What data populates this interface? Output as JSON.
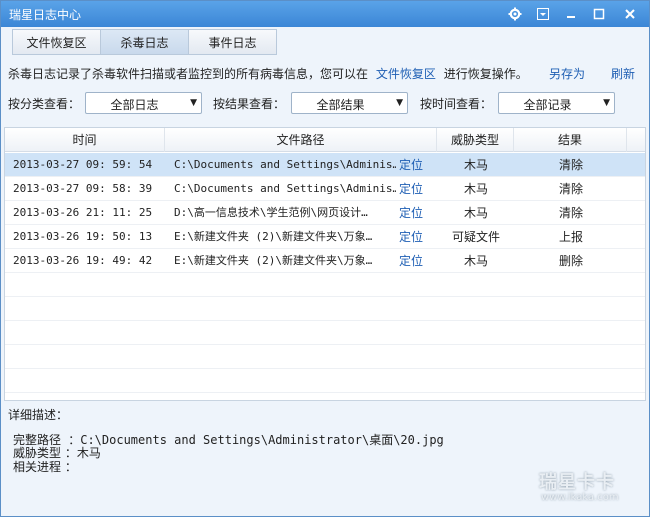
{
  "window": {
    "title": "瑞星日志中心"
  },
  "titlebar_icons": {
    "settings": "gear-icon",
    "menu": "dropdown-menu-icon",
    "minimize": "minimize-icon",
    "maximize": "maximize-icon",
    "close": "close-icon"
  },
  "tabs": [
    {
      "label": "文件恢复区"
    },
    {
      "label": "杀毒日志",
      "active": true
    },
    {
      "label": "事件日志"
    }
  ],
  "info": {
    "text_before": "杀毒日志记录了杀毒软件扫描或者监控到的所有病毒信息，您可以在",
    "link": "文件恢复区",
    "text_after": "进行恢复操作。",
    "save_as": "另存为",
    "refresh": "刷新"
  },
  "filters": {
    "category_label": "按分类查看：",
    "category_value": "全部日志",
    "result_label": "按结果查看：",
    "result_value": "全部结果",
    "time_label": "按时间查看：",
    "time_value": "全部记录"
  },
  "table": {
    "columns": [
      "时间",
      "文件路径",
      "威胁类型",
      "结果"
    ],
    "locate_label": "定位",
    "rows": [
      {
        "time": "2013-03-27 09: 59: 54",
        "path": "C:\\Documents  and Settings\\Adminis…",
        "type": "木马",
        "result": "清除",
        "selected": true
      },
      {
        "time": "2013-03-27 09: 58: 39",
        "path": "C:\\Documents  and Settings\\Adminis…",
        "type": "木马",
        "result": "清除"
      },
      {
        "time": "2013-03-26 21: 11: 25",
        "path": "D:\\高一信息技术\\学生范例\\网页设计…",
        "type": "木马",
        "result": "清除"
      },
      {
        "time": "2013-03-26 19: 50: 13",
        "path": "E:\\新建文件夹  (2)\\新建文件夹\\万象…",
        "type": "可疑文件",
        "result": "上报"
      },
      {
        "time": "2013-03-26 19: 49: 42",
        "path": "E:\\新建文件夹  (2)\\新建文件夹\\万象…",
        "type": "木马",
        "result": "删除"
      }
    ]
  },
  "detail": {
    "title": "详细描述：",
    "path_line": "完整路径 ：C:\\Documents  and Settings\\Administrator\\桌面\\20.jpg",
    "type_line": "威胁类型 ：木马",
    "process_line": "相关进程 ："
  },
  "watermark": {
    "big": "瑞星卡卡",
    "small": "www.ikaka.com"
  }
}
